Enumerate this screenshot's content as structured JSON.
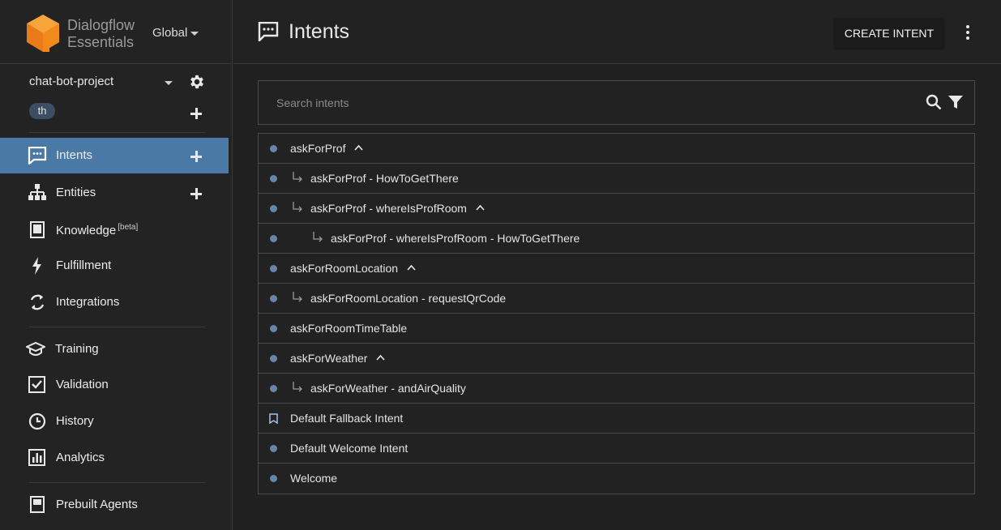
{
  "brand": {
    "name_line1": "Dialogflow",
    "name_line2": "Essentials",
    "region": "Global"
  },
  "project": {
    "name": "chat-bot-project",
    "language_chip": "th"
  },
  "nav": [
    {
      "label": "Intents",
      "icon": "intents-icon",
      "active": true,
      "has_add": true
    },
    {
      "label": "Entities",
      "icon": "entities-icon",
      "has_add": true
    },
    {
      "label": "Knowledge",
      "badge": "[beta]",
      "icon": "knowledge-icon"
    },
    {
      "label": "Fulfillment",
      "icon": "fulfillment-icon"
    },
    {
      "label": "Integrations",
      "icon": "integrations-icon"
    },
    {
      "label": "Training",
      "icon": "training-icon"
    },
    {
      "label": "Validation",
      "icon": "validation-icon"
    },
    {
      "label": "History",
      "icon": "history-icon"
    },
    {
      "label": "Analytics",
      "icon": "analytics-icon"
    },
    {
      "label": "Prebuilt Agents",
      "icon": "prebuilt-agents-icon"
    }
  ],
  "header": {
    "title": "Intents",
    "create_label": "CREATE INTENT"
  },
  "search": {
    "placeholder": "Search intents"
  },
  "intents": [
    {
      "name": "askForProf",
      "level": 0,
      "expanded": true
    },
    {
      "name": "askForProf - HowToGetThere",
      "level": 1
    },
    {
      "name": "askForProf - whereIsProfRoom",
      "level": 1,
      "expanded": true
    },
    {
      "name": "askForProf - whereIsProfRoom - HowToGetThere",
      "level": 2
    },
    {
      "name": "askForRoomLocation",
      "level": 0,
      "expanded": true
    },
    {
      "name": "askForRoomLocation - requestQrCode",
      "level": 1
    },
    {
      "name": "askForRoomTimeTable",
      "level": 0
    },
    {
      "name": "askForWeather",
      "level": 0,
      "expanded": true
    },
    {
      "name": "askForWeather - andAirQuality",
      "level": 1
    },
    {
      "name": "Default Fallback Intent",
      "level": 0,
      "marker": "bookmark"
    },
    {
      "name": "Default Welcome Intent",
      "level": 0
    },
    {
      "name": "Welcome",
      "level": 0
    }
  ],
  "colors": {
    "accent": "#4a79a6",
    "dot": "#7da7d9",
    "logo_orange": "#f28a1a"
  }
}
